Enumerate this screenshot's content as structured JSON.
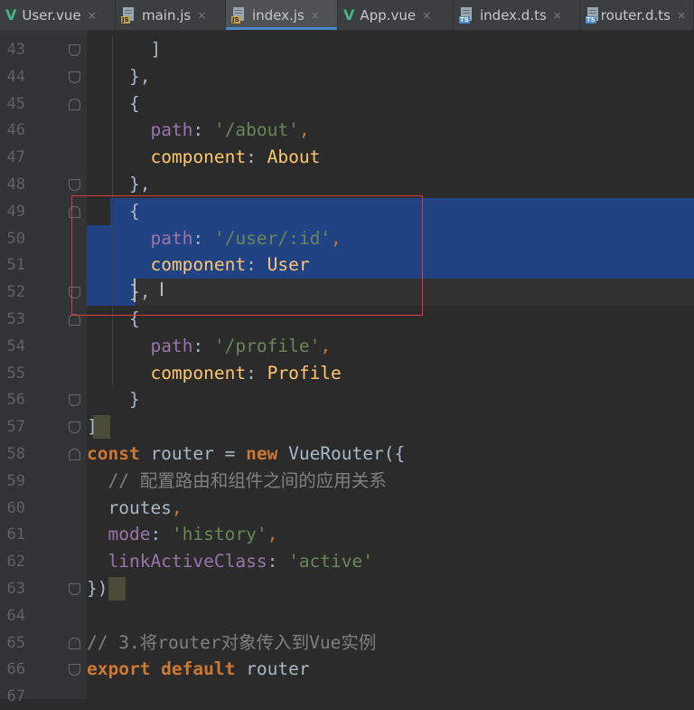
{
  "tabs": [
    {
      "label": "User.vue",
      "icon": "vue-icon",
      "badge": "",
      "active": false
    },
    {
      "label": "main.js",
      "icon": "js-file-icon",
      "badge": "JS",
      "active": false
    },
    {
      "label": "index.js",
      "icon": "js-file-icon",
      "badge": "JS",
      "active": true
    },
    {
      "label": "App.vue",
      "icon": "vue-icon",
      "badge": "",
      "active": false
    },
    {
      "label": "index.d.ts",
      "icon": "ts-file-icon",
      "badge": "TS",
      "active": false
    },
    {
      "label": "router.d.ts",
      "icon": "ts-file-icon",
      "badge": "TS",
      "active": false
    }
  ],
  "tab_close_glyph": "×",
  "vue_glyph": "V",
  "code_lines": [
    {
      "num": "43",
      "tokens": [
        [
          "      ]",
          "plain"
        ]
      ]
    },
    {
      "num": "44",
      "tokens": [
        [
          "    },",
          "brk-comma"
        ]
      ]
    },
    {
      "num": "45",
      "tokens": [
        [
          "    {",
          "plain"
        ]
      ]
    },
    {
      "num": "46",
      "tokens": [
        [
          "      ",
          "plain"
        ],
        [
          "path",
          "prop"
        ],
        [
          ": ",
          "plain"
        ],
        [
          "'/about'",
          "str"
        ],
        [
          ",",
          "punc"
        ]
      ]
    },
    {
      "num": "47",
      "tokens": [
        [
          "      ",
          "plain"
        ],
        [
          "component",
          "cls"
        ],
        [
          ": ",
          "plain"
        ],
        [
          "About",
          "cls"
        ]
      ]
    },
    {
      "num": "48",
      "tokens": [
        [
          "    },",
          "brk-comma"
        ]
      ]
    },
    {
      "num": "49",
      "tokens": [
        [
          "    {",
          "plain"
        ]
      ]
    },
    {
      "num": "50",
      "tokens": [
        [
          "      ",
          "plain"
        ],
        [
          "path",
          "prop"
        ],
        [
          ": ",
          "plain"
        ],
        [
          "'/user/:id'",
          "str"
        ],
        [
          ",",
          "punc"
        ]
      ]
    },
    {
      "num": "51",
      "tokens": [
        [
          "      ",
          "plain"
        ],
        [
          "component",
          "cls"
        ],
        [
          ": ",
          "plain"
        ],
        [
          "User",
          "cls"
        ]
      ]
    },
    {
      "num": "52",
      "tokens": [
        [
          "    },",
          "brk-comma"
        ]
      ]
    },
    {
      "num": "53",
      "tokens": [
        [
          "    {",
          "plain"
        ]
      ]
    },
    {
      "num": "54",
      "tokens": [
        [
          "      ",
          "plain"
        ],
        [
          "path",
          "prop"
        ],
        [
          ": ",
          "plain"
        ],
        [
          "'/profile'",
          "str"
        ],
        [
          ",",
          "punc"
        ]
      ]
    },
    {
      "num": "55",
      "tokens": [
        [
          "      ",
          "plain"
        ],
        [
          "component",
          "cls"
        ],
        [
          ": ",
          "plain"
        ],
        [
          "Profile",
          "cls"
        ]
      ]
    },
    {
      "num": "56",
      "tokens": [
        [
          "    }",
          "plain"
        ]
      ]
    },
    {
      "num": "57",
      "tokens": [
        [
          "]",
          "plain"
        ]
      ]
    },
    {
      "num": "58",
      "tokens": [
        [
          "const",
          "kw"
        ],
        [
          " router = ",
          "plain"
        ],
        [
          "new",
          "kw"
        ],
        [
          " VueRouter({",
          "plain"
        ]
      ]
    },
    {
      "num": "59",
      "tokens": [
        [
          "  // 配置路由和组件之间的应用关系",
          "cmt"
        ]
      ]
    },
    {
      "num": "60",
      "tokens": [
        [
          "  routes",
          "plain"
        ],
        [
          ",",
          "punc"
        ]
      ]
    },
    {
      "num": "61",
      "tokens": [
        [
          "  ",
          "plain"
        ],
        [
          "mode",
          "prop"
        ],
        [
          ": ",
          "plain"
        ],
        [
          "'history'",
          "str"
        ],
        [
          ",",
          "punc"
        ]
      ]
    },
    {
      "num": "62",
      "tokens": [
        [
          "  ",
          "plain"
        ],
        [
          "linkActiveClass",
          "prop"
        ],
        [
          ": ",
          "plain"
        ],
        [
          "'active'",
          "str"
        ]
      ]
    },
    {
      "num": "63",
      "tokens": [
        [
          "})",
          "plain"
        ]
      ]
    },
    {
      "num": "64",
      "tokens": []
    },
    {
      "num": "65",
      "tokens": [
        [
          "// 3.将router对象传入到Vue实例",
          "cmt"
        ]
      ]
    },
    {
      "num": "66",
      "tokens": [
        [
          "export default",
          "kw"
        ],
        [
          " router",
          "plain"
        ]
      ]
    },
    {
      "num": "67",
      "tokens": []
    }
  ],
  "selection": {
    "from_line": "49",
    "to_line": "52"
  },
  "caret_line": "52",
  "colors": {
    "background": "#2b2b2b",
    "selection": "#214283",
    "keyword": "#cc7832",
    "string": "#6a8759",
    "property": "#9876aa",
    "annotation_box": "#e23a3a"
  }
}
